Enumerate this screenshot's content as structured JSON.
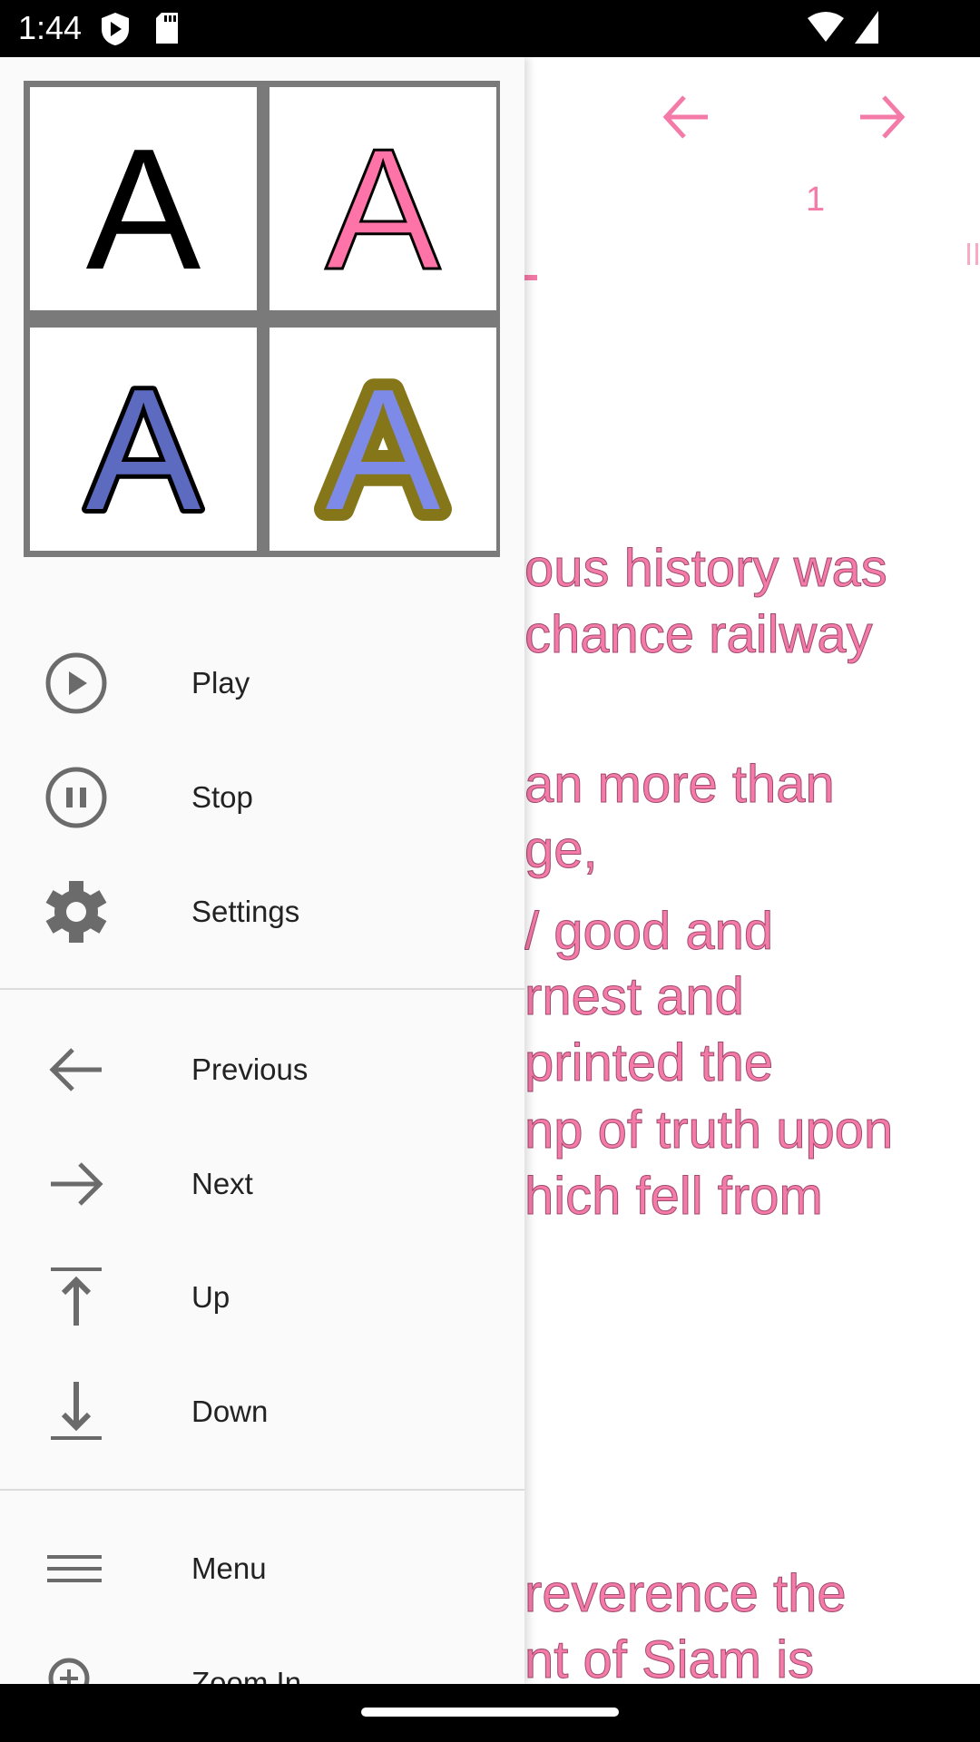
{
  "status_bar": {
    "time": "1:44",
    "icons": [
      "play-protect-icon",
      "sd-card-icon",
      "wifi-icon",
      "signal-icon"
    ]
  },
  "reader": {
    "page_number": "1",
    "accent_color": "#f47aa8",
    "text_lines": [
      "ous history was",
      "chance railway",
      "an more than",
      "ge,",
      "/ good and",
      "rnest and",
      "printed the",
      "np of truth upon",
      "hich fell from",
      "reverence the",
      "nt of Siam is"
    ]
  },
  "drawer": {
    "style_swatches": [
      {
        "letter": "A",
        "fill": "#000000",
        "stroke": "none"
      },
      {
        "letter": "A",
        "fill": "#ff74a8",
        "stroke": "#000000"
      },
      {
        "letter": "A",
        "fill": "#5c6bc0",
        "stroke": "#000000"
      },
      {
        "letter": "A",
        "fill": "#7e8ae8",
        "stroke": "#857719"
      }
    ],
    "items": [
      {
        "label": "Play",
        "icon": "play-circle-icon"
      },
      {
        "label": "Stop",
        "icon": "pause-circle-icon"
      },
      {
        "label": "Settings",
        "icon": "gear-icon"
      },
      {
        "label": "Previous",
        "icon": "arrow-left-icon"
      },
      {
        "label": "Next",
        "icon": "arrow-right-icon"
      },
      {
        "label": "Up",
        "icon": "arrow-up-to-top-icon"
      },
      {
        "label": "Down",
        "icon": "arrow-down-to-bottom-icon"
      },
      {
        "label": "Menu",
        "icon": "menu-icon"
      },
      {
        "label": "Zoom In",
        "icon": "zoom-in-icon"
      }
    ]
  }
}
